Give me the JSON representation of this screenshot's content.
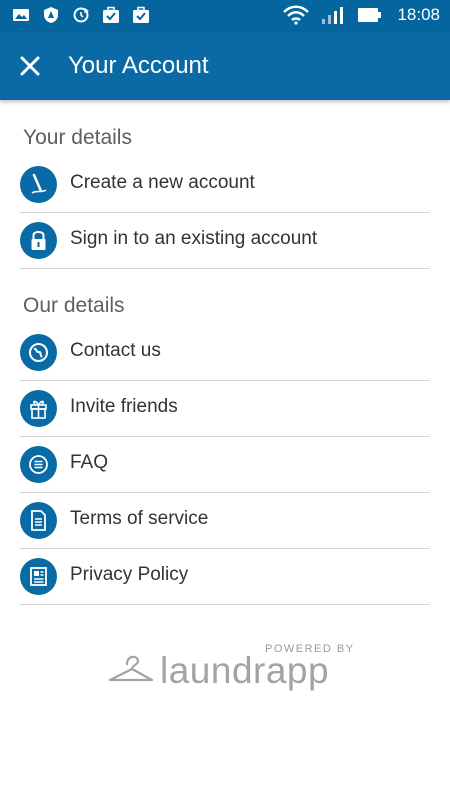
{
  "status_bar": {
    "time": "18:08",
    "left_icons": [
      "photo-icon",
      "shield-icon",
      "sync-icon",
      "briefcase-check-icon",
      "briefcase-check-icon"
    ],
    "right_icons": [
      "wifi-icon",
      "signal-icon",
      "battery-icon"
    ]
  },
  "app_bar": {
    "title": "Your Account",
    "close_icon": "close-icon"
  },
  "sections": {
    "your_details": {
      "title": "Your details",
      "items": [
        {
          "label": "Create a new account",
          "icon": "pen-icon"
        },
        {
          "label": "Sign in to an existing account",
          "icon": "lock-icon"
        }
      ]
    },
    "our_details": {
      "title": "Our details",
      "items": [
        {
          "label": "Contact us",
          "icon": "globe-icon"
        },
        {
          "label": "Invite friends",
          "icon": "gift-icon"
        },
        {
          "label": "FAQ",
          "icon": "list-icon"
        },
        {
          "label": "Terms of service",
          "icon": "document-icon"
        },
        {
          "label": "Privacy Policy",
          "icon": "newspaper-icon"
        }
      ]
    }
  },
  "footer": {
    "powered_by": "POWERED BY",
    "brand": "laundrapp"
  },
  "colors": {
    "primary": "#0a6aa5",
    "status_bar": "#05659e",
    "divider": "#d6d6d6",
    "brand_gray": "#a3a3a3"
  }
}
